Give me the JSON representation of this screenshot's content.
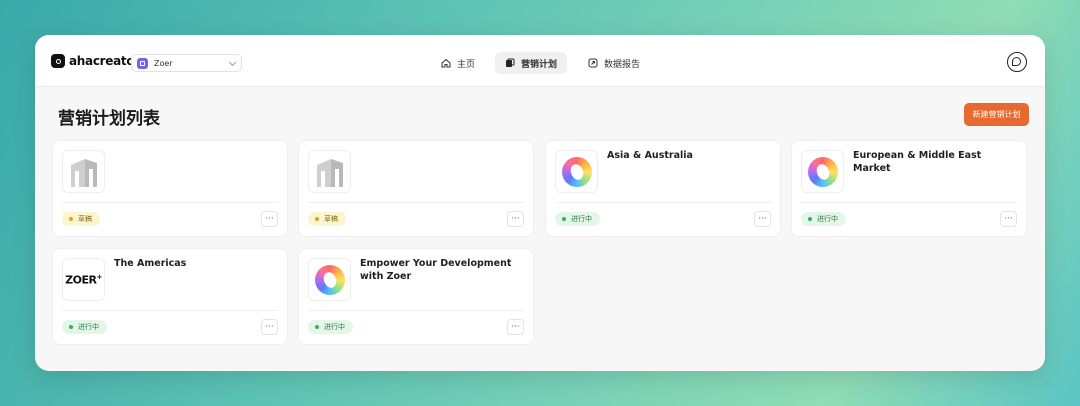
{
  "brand": {
    "name": "ahacreator"
  },
  "workspace": {
    "name": "Zoer"
  },
  "nav": [
    {
      "label": "主页",
      "icon": "home-icon",
      "active": false
    },
    {
      "label": "营销计划",
      "icon": "plan-icon",
      "active": true
    },
    {
      "label": "数据报告",
      "icon": "report-icon",
      "active": false
    }
  ],
  "page": {
    "title": "营销计划列表",
    "new_button": "新建营销计划"
  },
  "status_labels": {
    "draft": "草稿",
    "active": "进行中"
  },
  "more_label": "···",
  "cards": [
    {
      "title": "",
      "thumb": "building-placeholder",
      "status": "草稿"
    },
    {
      "title": "",
      "thumb": "building-placeholder",
      "status": "草稿"
    },
    {
      "title": "Asia & Australia",
      "thumb": "zoer-ring-logo",
      "status": "进行中"
    },
    {
      "title": "European & Middle East Market",
      "thumb": "zoer-ring-logo",
      "status": "进行中"
    },
    {
      "title": "The Americas",
      "thumb": "zoer-wordmark",
      "thumb_text": "ZOER",
      "thumb_sup": "+",
      "status": "进行中"
    },
    {
      "title": "Empower Your Development with Zoer",
      "thumb": "zoer-ring-logo",
      "status": "进行中"
    }
  ],
  "colors": {
    "accent": "#e8692f",
    "active_badge": "#35b25c",
    "draft_badge": "#d6a81a"
  }
}
